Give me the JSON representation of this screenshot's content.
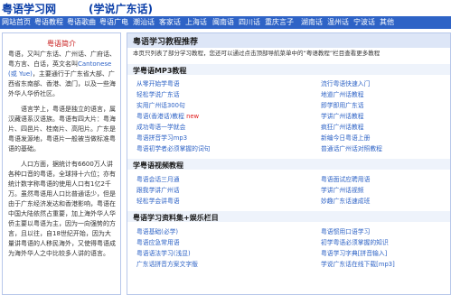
{
  "site": {
    "title": "粤语学习网",
    "subtitle": "(学说广东话)"
  },
  "nav": [
    "网站首页",
    "粤语教程",
    "粤语歌曲",
    "粤语广电",
    "潮汕话",
    "客家话",
    "上海话",
    "闽南语",
    "四川话",
    "重庆言子",
    "湖南话",
    "温州话",
    "宁波话",
    "其他"
  ],
  "sidebar": {
    "title": "粤语简介",
    "paragraphs": [
      {
        "before": "粤语，又叫广东话、广州话、广府话、粤方言、白话，英文名叫",
        "blue": "Cantonese (或 Yue)",
        "after": "，主要通行于广东省大部、广西省东南部、香港、澳门，以及一些海外华人华侨社区。"
      },
      {
        "before": "",
        "blue": "",
        "after": "语言学上，粤语是独立的语言，属汉藏语系汉语族。粤语有四大片：粤海片、四邑片、桂南片、高阳片。广东是粤语发源地，粤语片一般被当做标准粤语的基础。"
      },
      {
        "before": "",
        "blue": "",
        "after": "人口方面，据统计有6600万人讲各种口音的粤语，全球排十六位；亦有统计数字称粤语的使用人口有1亿2千万。虽然粤语用人口比普通话少，但是由于广东经济发达和香港影响，粤语在中国大陆依然占重要，加上海外华人华侨主要以粤语为主，因为一向强势的方言，且以往，自18世纪开始，因为大量讲粤语的人移民海外，又使得粤语成为海外华人之中比较多人讲的语言。"
      }
    ]
  },
  "main": {
    "heading": "粤语学习教程推荐",
    "intro": "本页只列表了部分学习教程，您还可以通过点击顶部导航菜单中的“粤语教程”栏目查看更多教程",
    "sections": [
      {
        "title": "学粤语MP3教程",
        "left": [
          {
            "text": "从零开始学粤语",
            "new": ""
          },
          {
            "text": "轻松学说广东话",
            "new": ""
          },
          {
            "text": "实用广州话300句",
            "new": ""
          },
          {
            "text": "粤语(香港话)教程",
            "new": "new"
          },
          {
            "text": "成功粤语一学就会",
            "new": ""
          },
          {
            "text": "粤语拼音学习mp3",
            "new": ""
          },
          {
            "text": "粤语初学者必须掌握的词句",
            "new": ""
          }
        ],
        "right": [
          {
            "text": "流行粤语快速入门"
          },
          {
            "text": "地道广州话教程"
          },
          {
            "text": "即学即用广东话"
          },
          {
            "text": "学讲广州话教程"
          },
          {
            "text": "疯狂广州话教程"
          },
          {
            "text": "新编今日粤语上册"
          },
          {
            "text": "普通话广州话对照教程"
          }
        ]
      },
      {
        "title": "学粤语视频教程",
        "left": [
          {
            "text": "粤语会话三月通"
          },
          {
            "text": "跟我学讲广州话"
          },
          {
            "text": "轻松学会讲粤语"
          }
        ],
        "right": [
          {
            "text": "粤语面试应聘用语"
          },
          {
            "text": "学讲广州话视频"
          },
          {
            "text": "妙趣广东话速成班"
          }
        ]
      },
      {
        "title": "粤语学习资料集+娱乐栏目",
        "left": [
          {
            "text": "粤语基础(必学)"
          },
          {
            "text": "粤语应急常用语"
          },
          {
            "text": "粤语语法学习(浅显)"
          },
          {
            "text": "广东话拼音方案文字版"
          }
        ],
        "right": [
          {
            "text": "粤语惯用口语学习"
          },
          {
            "text": "初学粤语必须掌握的知识"
          },
          {
            "text": "粤语学习字典[拼音输入]"
          },
          {
            "text": "学说广东话在线下载[mp3]"
          }
        ]
      }
    ]
  }
}
